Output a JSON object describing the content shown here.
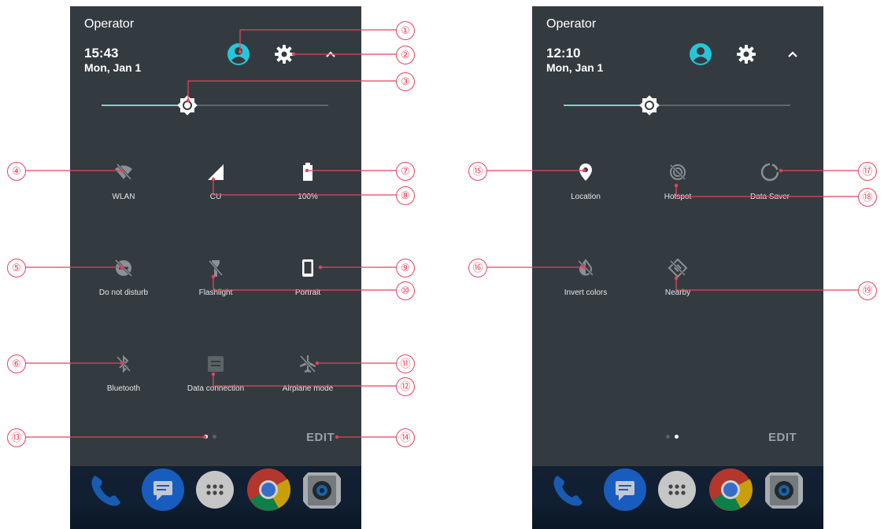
{
  "panels": [
    {
      "operator": "Operator",
      "time": "15:43",
      "date": "Mon, Jan 1",
      "tiles": [
        {
          "label": "WLAN",
          "icon": "wifi-off-icon"
        },
        {
          "label": "CU",
          "icon": "cell-signal-icon"
        },
        {
          "label": "100%",
          "icon": "battery-icon"
        },
        {
          "label": "Do not disturb",
          "icon": "do-not-disturb-off-icon"
        },
        {
          "label": "Flashlight",
          "icon": "flashlight-off-icon"
        },
        {
          "label": "Portrait",
          "icon": "portrait-icon"
        },
        {
          "label": "Bluetooth",
          "icon": "bluetooth-off-icon"
        },
        {
          "label": "Data connection",
          "icon": "data-connection-icon"
        },
        {
          "label": "Airplane mode",
          "icon": "airplane-icon"
        }
      ],
      "page_dots": {
        "active": 1,
        "count": 2
      },
      "edit": "EDIT"
    },
    {
      "operator": "Operator",
      "time": "12:10",
      "date": "Mon, Jan 1",
      "tiles": [
        {
          "label": "Location",
          "icon": "location-icon"
        },
        {
          "label": "Hotspot",
          "icon": "hotspot-off-icon"
        },
        {
          "label": "Data Saver",
          "icon": "data-saver-icon"
        },
        {
          "label": "Invert colors",
          "icon": "invert-colors-off-icon"
        },
        {
          "label": "Nearby",
          "icon": "nearby-off-icon"
        }
      ],
      "page_dots": {
        "active": 2,
        "count": 2
      },
      "edit": "EDIT"
    }
  ],
  "brightness_level": 0.38,
  "callouts": [
    "①",
    "②",
    "③",
    "④",
    "⑤",
    "⑥",
    "⑦",
    "⑧",
    "⑨",
    "⑩",
    "⑪",
    "⑫",
    "⑬",
    "⑭",
    "⑮",
    "⑯",
    "⑰",
    "⑱",
    "⑲"
  ],
  "colors": {
    "panel": "#343b40",
    "accent": "#26c6da",
    "callout": "#e8425c",
    "slider_fill": "#7fcfcf"
  },
  "dock_icons": [
    "phone-icon",
    "messages-icon",
    "app-drawer-icon",
    "chrome-icon",
    "camera-icon"
  ]
}
